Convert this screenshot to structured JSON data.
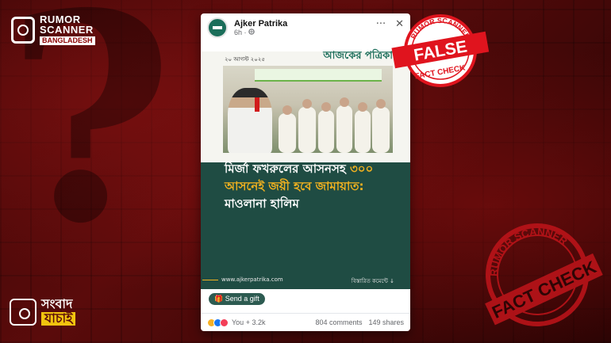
{
  "brand": {
    "name_line1": "RUMOR",
    "name_line2": "SCANNER",
    "country": "BANGLADESH",
    "bottom_line1": "সংবাদ",
    "bottom_line2": "যাচাই"
  },
  "post": {
    "page_name": "Ajker Patrika",
    "time": "6h · ",
    "globe_icon": "globe-icon",
    "image": {
      "date": "২০ আগস্ট ২০২৫",
      "logo": "আজকের পত্রিকা",
      "headline_part1": "মির্জা ফখরুলের আসনসহ ",
      "headline_highlight1": "৩০০",
      "headline_highlight2": "আসনেই জয়ী হবে জামায়াত:",
      "headline_part2": "মাওলানা হালিম",
      "url": "www.ajkerpatrika.com",
      "more": "বিস্তারিত কমেন্টে ↓"
    },
    "send_gift": "Send a gift",
    "reactions_text": "You + 3.2k",
    "comments": "804 comments",
    "shares": "149 shares"
  },
  "stamps": {
    "false_top": "RUMOR SCANNER",
    "false_label": "FALSE",
    "false_bottom": "FACT CHECK",
    "big_top": "RUMOR SCANNER",
    "big_bottom": "FACT CHECK"
  },
  "colors": {
    "stamp_red": "#e0141e",
    "headline_highlight": "#f3b21f",
    "panel_green": "#1f4c43"
  }
}
